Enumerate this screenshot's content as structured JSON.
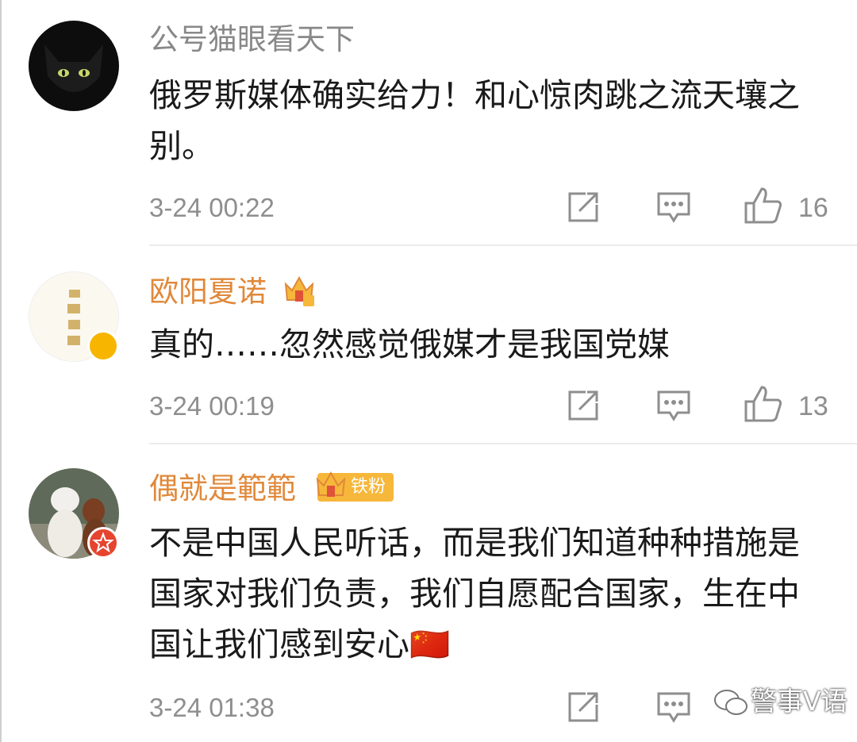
{
  "comments": [
    {
      "username": "公号猫眼看天下",
      "username_color": "#888888",
      "text": "俄罗斯媒体确实给力！和心惊肉跳之流天壤之别。",
      "time": "3-24 00:22",
      "likes": "16",
      "avatar": "black-cat-avatar"
    },
    {
      "username": "欧阳夏诺",
      "username_color": "#e0893a",
      "text": "真的……忽然感觉俄媒才是我国党媒",
      "time": "3-24 00:19",
      "likes": "13",
      "avatar": "calligraphy-avatar"
    },
    {
      "username": "偶就是範範",
      "username_color": "#e0893a",
      "fan_badge": "铁粉",
      "text": "不是中国人民听话，而是我们知道种种措施是国家对我们负责，我们自愿配合国家，生在中国让我们感到安心🇨🇳",
      "time": "3-24 01:38",
      "likes": "",
      "avatar": "dogs-avatar"
    }
  ],
  "watermark": "警事V语",
  "colors": {
    "meta_gray": "#8e8e8e",
    "accent_orange": "#e0893a",
    "vip_gold": "#f7b500"
  }
}
